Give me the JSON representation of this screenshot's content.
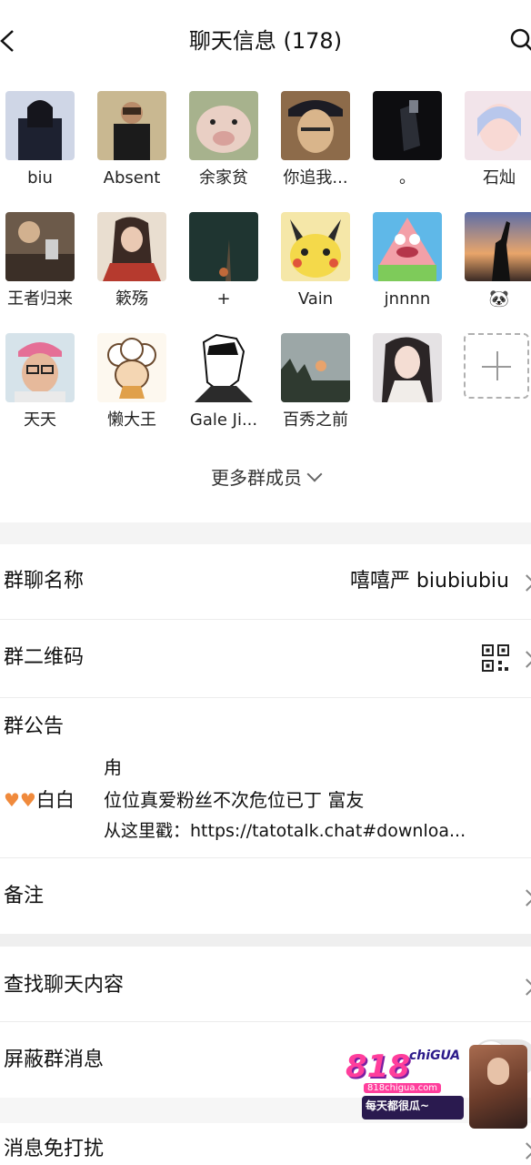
{
  "header": {
    "title": "聊天信息 (178)"
  },
  "members": [
    {
      "name": "biu",
      "avatar": "avatar-person-suit-dark"
    },
    {
      "name": "Absent",
      "avatar": "avatar-person-suit-mask"
    },
    {
      "name": "余家贫",
      "avatar": "avatar-pig"
    },
    {
      "name": "你追我...",
      "avatar": "avatar-anime-cap"
    },
    {
      "name": "。",
      "avatar": "avatar-dark-figure"
    },
    {
      "name": "石灿",
      "avatar": "avatar-anime-light"
    },
    {
      "name": "王者归来",
      "avatar": "avatar-person-drink"
    },
    {
      "name": "簌殇",
      "avatar": "avatar-ink-painting"
    },
    {
      "name": "+",
      "avatar": "avatar-dark-green"
    },
    {
      "name": "Vain",
      "avatar": "avatar-pikachu"
    },
    {
      "name": "jnnnn",
      "avatar": "avatar-patrick"
    },
    {
      "name": "🐼",
      "avatar": "avatar-sunset-silhouette"
    },
    {
      "name": "天天",
      "avatar": "avatar-person-pink-cap"
    },
    {
      "name": "懒大王",
      "avatar": "avatar-cartoon-sheep"
    },
    {
      "name": "Gale Ji...",
      "avatar": "avatar-manga-sketch"
    },
    {
      "name": "百秀之前",
      "avatar": "avatar-sunset-trees"
    },
    {
      "name": "",
      "avatar": "avatar-girl-portrait"
    }
  ],
  "more_members_label": "更多群成员",
  "settings": {
    "group_name_label": "群聊名称",
    "group_name_value": "嘻嘻严 biubiubiu",
    "qr_label": "群二维码",
    "notice_label": "群公告",
    "notice_author": "白白",
    "notice_lines": [
      "甪",
      "位位真爱粉丝不次危位已丁 富友",
      "从这里戳：https://tatotalk.chat#downloa..."
    ],
    "remark_label": "备注",
    "search_label": "查找聊天内容",
    "block_label": "屏蔽群消息",
    "dnd_label": "消息免打扰"
  },
  "watermark": {
    "logo": "818",
    "sub": "chiGUA",
    "url": "818chigua.com",
    "slogan": "每天都很瓜~"
  },
  "colors": {
    "divider": "#efefef",
    "heart": "#f08a3c",
    "watermark_pink": "#ff3e9c"
  }
}
